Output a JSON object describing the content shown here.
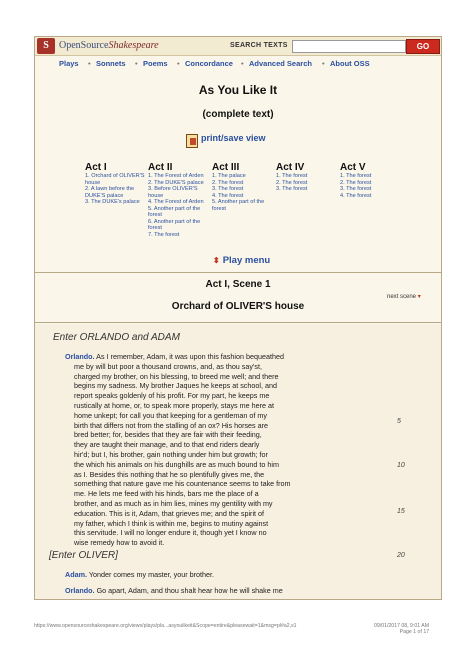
{
  "header": {
    "logo_letter": "S",
    "brand_plain": "OpenSource",
    "brand_italic": "Shakespeare",
    "search_label": "SEARCH TEXTS",
    "go": "GO"
  },
  "nav": [
    "Plays",
    "Sonnets",
    "Poems",
    "Concordance",
    "Advanced Search",
    "About OSS"
  ],
  "title": "As You Like It",
  "subtitle": "(complete text)",
  "print": "print/save view",
  "acts": [
    {
      "name": "Act I",
      "scenes": [
        "1. Orchard of OLIVER'S house",
        "2. A lawn before the DUKE'S palace",
        "3. The DUKE's palace"
      ]
    },
    {
      "name": "Act II",
      "scenes": [
        "1. The Forest of Arden",
        "2. The DUKE'S palace",
        "3. Before OLIVER'S house",
        "4. The Forest of Arden",
        "5. Another part of the forest",
        "6. Another part of the forest",
        "7. The forest"
      ]
    },
    {
      "name": "Act III",
      "scenes": [
        "1. The palace",
        "2. The forest",
        "3. The forest",
        "4. The forest",
        "5. Another part of the forest"
      ]
    },
    {
      "name": "Act IV",
      "scenes": [
        "1. The forest",
        "2. The forest",
        "3. The forest"
      ]
    },
    {
      "name": "Act V",
      "scenes": [
        "1. The forest",
        "2. The forest",
        "3. The forest",
        "4. The forest"
      ]
    }
  ],
  "play_menu": "Play menu",
  "scene_heading": "Act I, Scene 1",
  "next_scene": "next scene",
  "location": "Orchard of OLIVER'S house",
  "stage_direction_1": "Enter ORLANDO and ADAM",
  "speech_1": {
    "speaker": "Orlando.",
    "lines": [
      "As I remember, Adam, it was upon this fashion bequeathed",
      "me by will but poor a thousand crowns, and, as thou say'st,",
      "charged my brother, on his blessing, to breed me well; and there",
      "begins my sadness. My brother Jaques he keeps at school, and",
      "report speaks goldenly of his profit. For my part, he keeps me",
      "rustically at home, or, to speak more properly, stays me here at",
      "home unkept; for call you that keeping for a gentleman of my",
      "birth that differs not from the stalling of an ox? His horses are",
      "bred better; for, besides that they are fair with their feeding,",
      "they are taught their manage, and to that end riders dearly",
      "hir'd; but I, his brother, gain nothing under him but growth; for",
      "the which his animals on his dunghills are as much bound to him",
      "as I. Besides this nothing that he so plentifully gives me, the",
      "something that nature gave me his countenance seems to take from",
      "me. He lets me feed with his hinds, bars me the place of a",
      "brother, and as much as in him lies, mines my gentility with my",
      "education. This is it, Adam, that grieves me; and the spirit of",
      "my father, which I think is within me, begins to mutiny against",
      "this servitude. I will no longer endure it, though yet I know no",
      "wise remedy how to avoid it."
    ],
    "line_numbers": [
      "5",
      "10",
      "15",
      "20"
    ]
  },
  "stage_direction_2": "[Enter OLIVER]",
  "speech_2": {
    "speaker": "Adam.",
    "text": "Yonder comes my master, your brother."
  },
  "speech_3": {
    "speaker": "Orlando.",
    "text": "Go apart, Adam, and thou shalt hear how he will shake me"
  },
  "footer": {
    "url": "https://www.opensourceshakespeare.org/views/plays/pla...asyoulikeit&Scope=entire&pleasewait=1&msg=pl#a2,s1",
    "date": "09/01/2017 08, 9:01 AM",
    "page": "Page 1 of 17"
  }
}
